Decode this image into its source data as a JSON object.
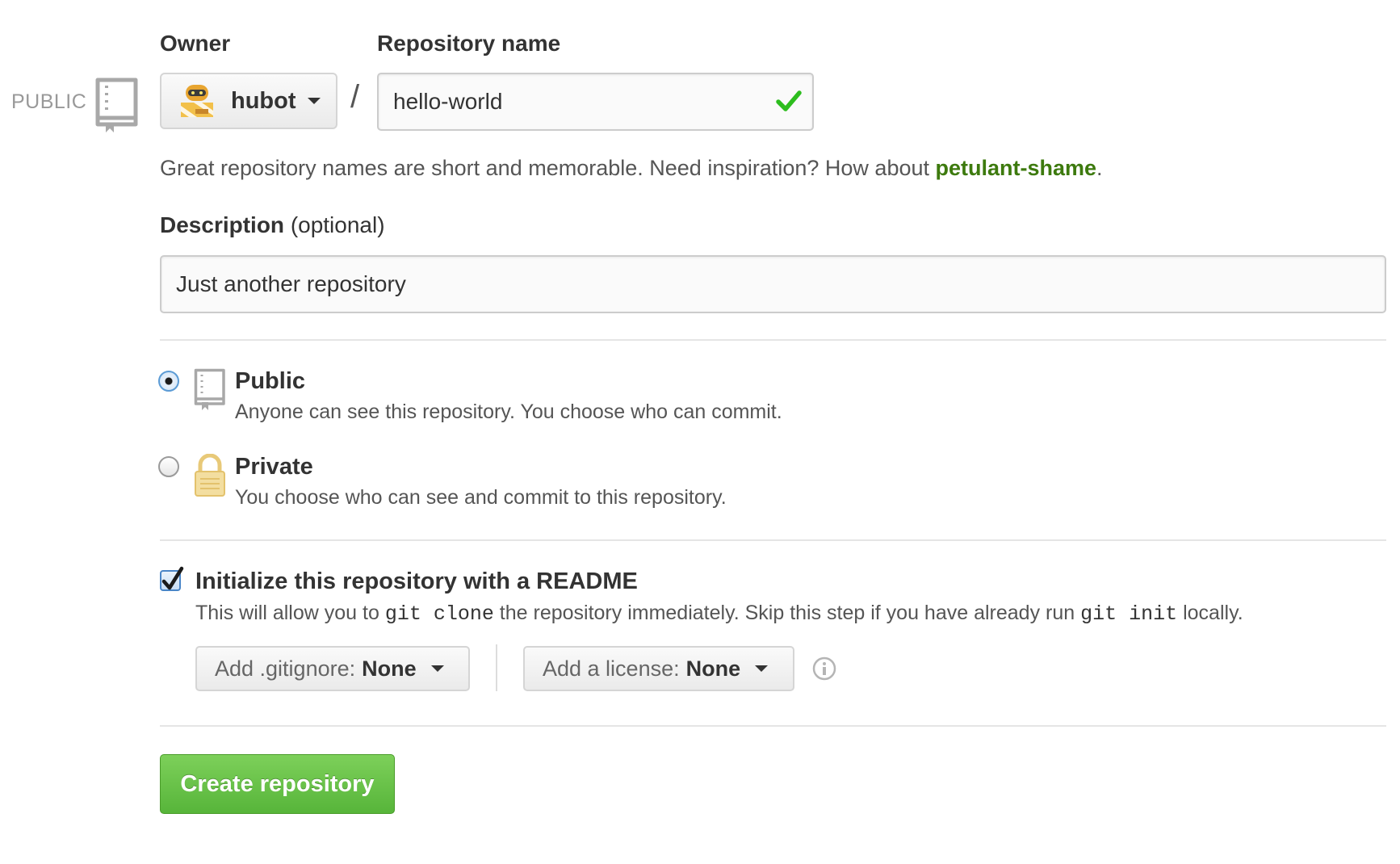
{
  "owner": {
    "heading": "Owner",
    "name": "hubot"
  },
  "repository": {
    "heading": "Repository name",
    "separator": "/",
    "value": "hello-world"
  },
  "visibility_indicator": "PUBLIC",
  "hint": {
    "prefix": "Great repository names are short and memorable. Need inspiration? How about ",
    "suggestion": "petulant-shame",
    "suffix": "."
  },
  "description": {
    "label": "Description",
    "optional": "(optional)",
    "value": "Just another repository"
  },
  "visibility": {
    "public": {
      "title": "Public",
      "description": "Anyone can see this repository. You choose who can commit.",
      "selected": true
    },
    "private": {
      "title": "Private",
      "description": "You choose who can see and commit to this repository.",
      "selected": false
    }
  },
  "readme": {
    "checked": true,
    "title": "Initialize this repository with a README",
    "desc_part1": "This will allow you to ",
    "code1": "git clone",
    "desc_part2": " the repository immediately. Skip this step if you have already run ",
    "code2": "git init",
    "desc_part3": " locally."
  },
  "gitignore": {
    "label": "Add .gitignore:",
    "value": "None"
  },
  "license": {
    "label": "Add a license:",
    "value": "None"
  },
  "create_button": "Create repository",
  "colors": {
    "accent_green": "#3d7a0e",
    "button_green": "#6cc644",
    "check_green": "#2dbd1e",
    "lock_gold": "#e8c978"
  }
}
